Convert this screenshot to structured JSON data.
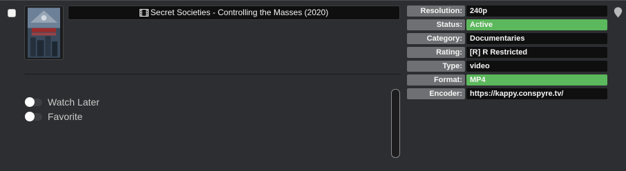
{
  "title": "Secret Societies - Controlling the Masses (2020)",
  "icons": {
    "title": "film-icon",
    "pin": "map-pin-icon",
    "poster": "poster-thumbnail"
  },
  "toggles": [
    {
      "label": "Watch Later",
      "on": false
    },
    {
      "label": "Favorite",
      "on": false
    }
  ],
  "info": [
    {
      "label": "Resolution:",
      "value": "240p",
      "highlight": false
    },
    {
      "label": "Status:",
      "value": "Active",
      "highlight": true
    },
    {
      "label": "Category:",
      "value": "Documentaries",
      "highlight": false
    },
    {
      "label": "Rating:",
      "value": "[R] R Restricted",
      "highlight": false
    },
    {
      "label": "Type:",
      "value": "video",
      "highlight": false
    },
    {
      "label": "Format:",
      "value": "MP4",
      "highlight": true
    },
    {
      "label": "Encoder:",
      "value": "https://kappy.conspyre.tv/",
      "highlight": false
    }
  ],
  "colors": {
    "background": "#2d2e31",
    "label_bg": "#6f7073",
    "value_bg": "#0f0f10",
    "highlight": "#5cb85c"
  }
}
